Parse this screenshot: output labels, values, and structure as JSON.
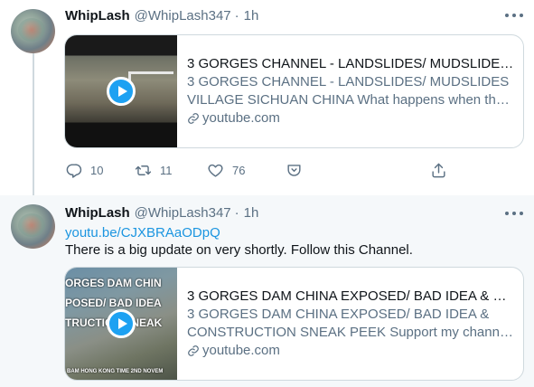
{
  "tweets": [
    {
      "author": {
        "name": "WhipLash",
        "handle": "@WhipLash347",
        "separator": "·",
        "time": "1h"
      },
      "card": {
        "title": "3 GORGES CHANNEL - LANDSLIDES/ MUDSLIDES VIL...",
        "description": "3 GORGES CHANNEL - LANDSLIDES/ MUDSLIDES VILLAGE SICHUAN CHINA What happens when the ...",
        "domain": "youtube.com"
      },
      "actions": {
        "replies": "10",
        "retweets": "11",
        "likes": "76"
      }
    },
    {
      "author": {
        "name": "WhipLash",
        "handle": "@WhipLash347",
        "separator": "·",
        "time": "1h"
      },
      "link": "youtu.be/CJXBRAaODpQ",
      "text": "There is a big update on very shortly. Follow this Channel.",
      "card": {
        "thumb_text": [
          "ORGES DAM CHIN",
          "POSED/ BAD IDEA",
          "TRUCTION SNEAK"
        ],
        "thumb_caption": "BAM HONG KONG TIME 2ND NOVEM",
        "title": "3 GORGES DAM CHINA EXPOSED/ BAD IDEA & CON...",
        "description": "3 GORGES DAM CHINA EXPOSED/ BAD IDEA & CONSTRUCTION SNEAK PEEK Support my channel at...",
        "domain": "youtube.com"
      }
    }
  ],
  "icons": {
    "more": "more-horizontal-icon",
    "play": "play-icon",
    "domain": "link-icon",
    "reply": "reply-icon",
    "retweet": "retweet-icon",
    "like": "heart-icon",
    "tip": "tip-jar-icon",
    "share": "share-icon"
  },
  "colors": {
    "accent": "#1da1f2",
    "link": "#1b95e0",
    "secondary_text": "#5b7083",
    "border": "#cfd9de",
    "highlight_bg": "#f5f8fa"
  }
}
